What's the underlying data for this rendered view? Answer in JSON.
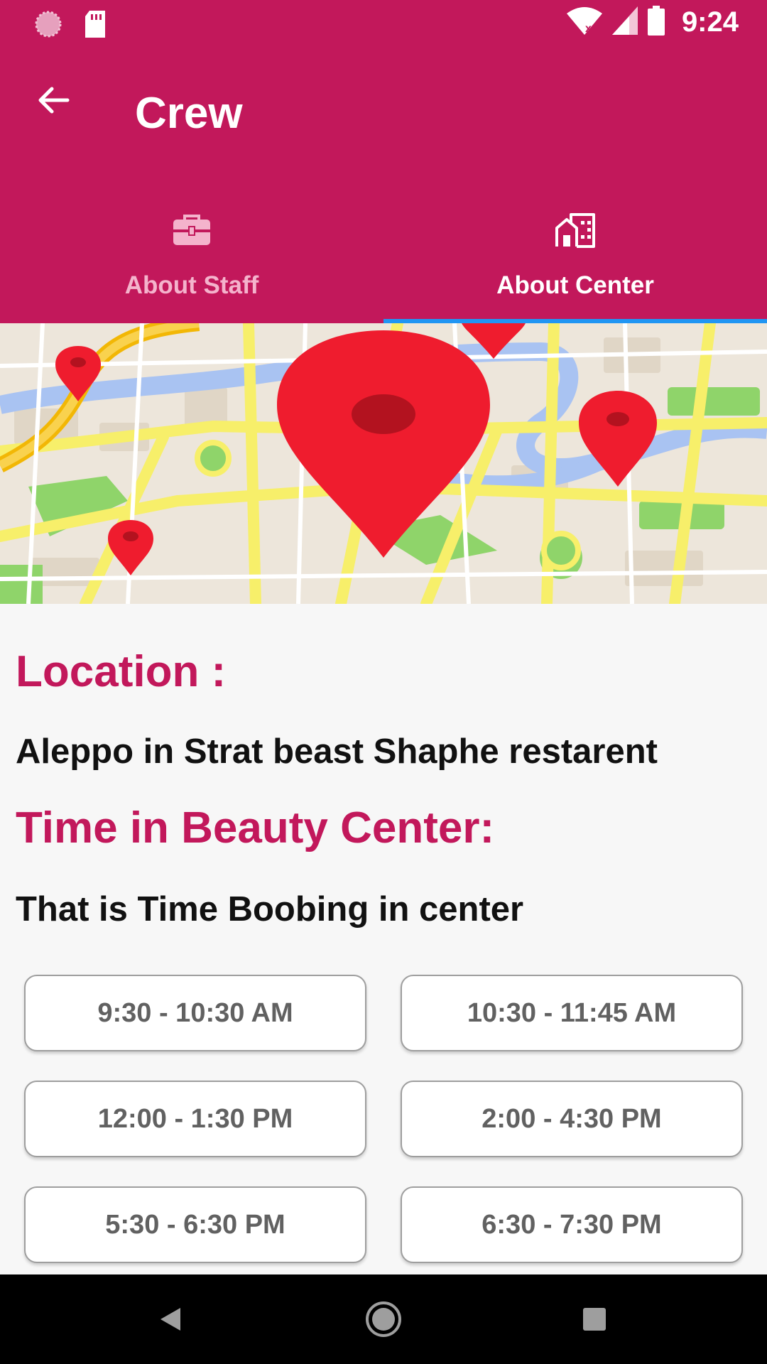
{
  "status_bar": {
    "time": "9:24"
  },
  "toolbar": {
    "title": "Crew"
  },
  "tabs": [
    {
      "label": "About Staff",
      "icon": "briefcase-icon",
      "active": false
    },
    {
      "label": "About Center",
      "icon": "building-icon",
      "active": true
    }
  ],
  "colors": {
    "primary": "#c2185b",
    "tab_indicator": "#2196f3",
    "heading": "#c2185b"
  },
  "content": {
    "location_heading": "Location :",
    "location_text": "Aleppo in Strat beast Shaphe restarent",
    "time_heading": "Time in Beauty Center:",
    "time_text": "That is Time Boobing in center"
  },
  "time_slots": [
    "9:30 - 10:30 AM",
    "10:30 - 11:45 AM",
    "12:00 - 1:30 PM",
    "2:00 - 4:30 PM",
    "5:30 - 6:30 PM",
    "6:30 - 7:30 PM"
  ]
}
